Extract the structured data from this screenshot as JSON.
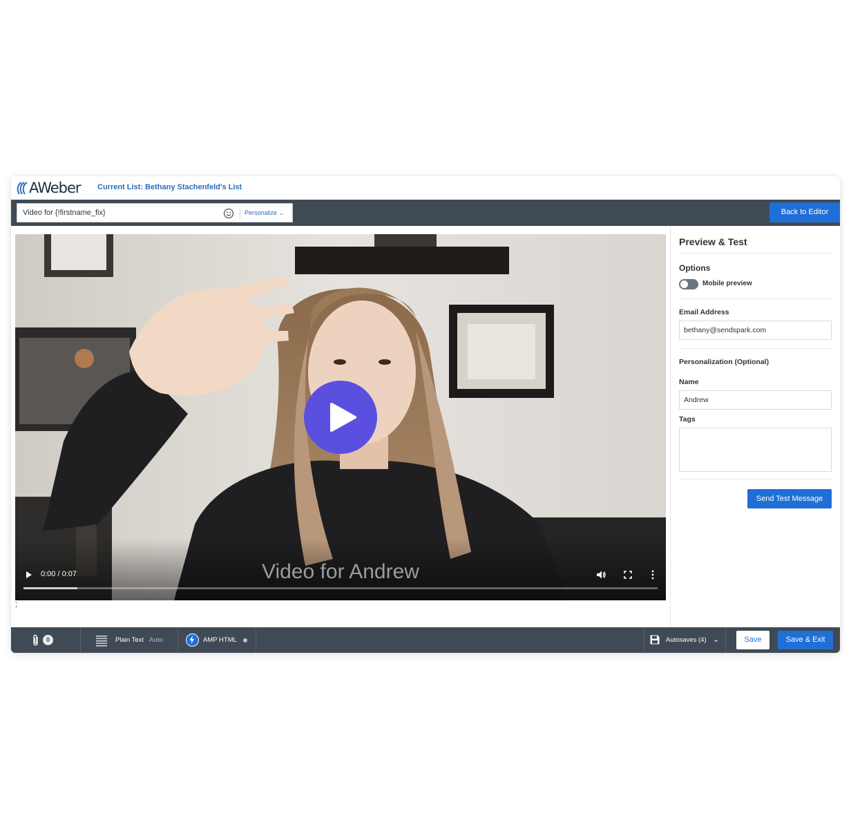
{
  "header": {
    "logo_text": "AWeber",
    "current_list": "Current List: Bethany Stachenfeld's List"
  },
  "subject": {
    "value": "Video for {!firstname_fix}",
    "personalize_label": "Personalize",
    "back_button": "Back to Editor"
  },
  "video": {
    "caption": "Video for Andrew",
    "time": "0:00 / 0:07",
    "progress_fraction": 0.085,
    "after_text": ";"
  },
  "panel": {
    "title": "Preview & Test",
    "options_title": "Options",
    "mobile_preview_label": "Mobile preview",
    "mobile_preview_enabled": false,
    "email_label": "Email Address",
    "email_value": "bethany@sendspark.com",
    "personalization_title": "Personalization (Optional)",
    "name_label": "Name",
    "name_value": "Andrew",
    "tags_label": "Tags",
    "tags_value": "",
    "send_button": "Send Test Message"
  },
  "bottombar": {
    "attachments_count": "0",
    "plain_text_label": "Plain Text",
    "plain_text_mode": "Auto",
    "amp_label": "AMP HTML",
    "autosaves_label": "Autosaves (4)",
    "save_button": "Save",
    "save_exit_button": "Save & Exit"
  },
  "colors": {
    "accent": "#1f6fd6",
    "bar": "#3f4a55",
    "play_button": "#5b4fe0",
    "link": "#2a6eb8"
  }
}
